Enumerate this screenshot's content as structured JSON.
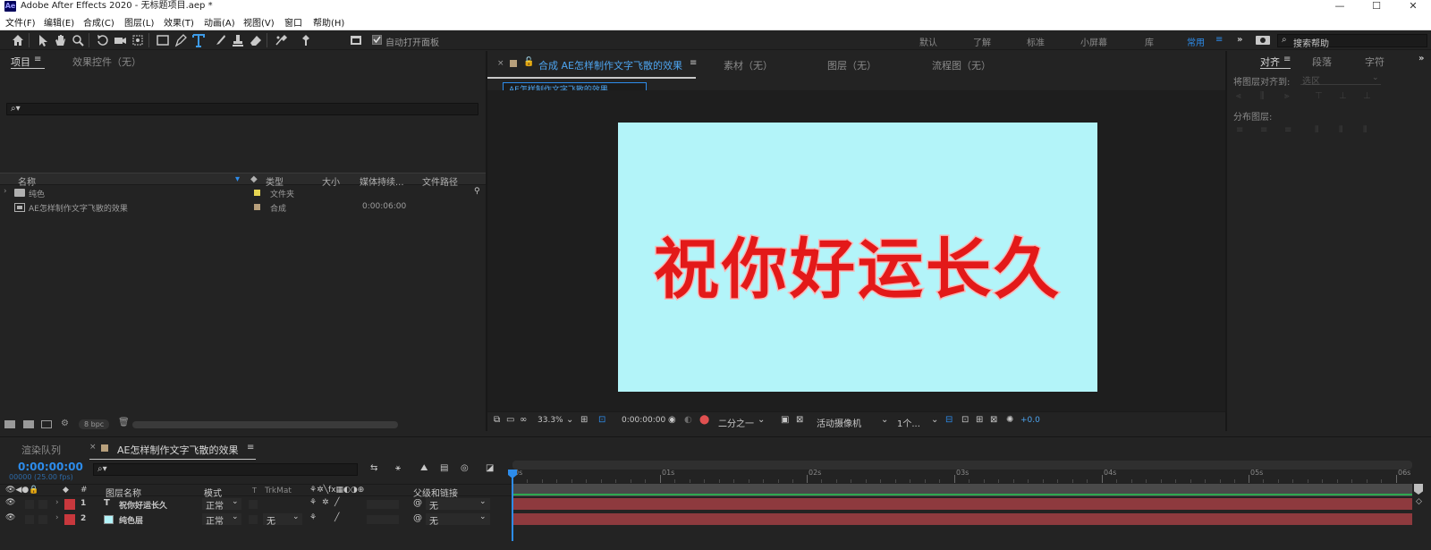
{
  "app": {
    "logo": "Ae",
    "window_title": "Adobe After Effects 2020 - 无标题项目.aep *",
    "controls": [
      "—",
      "☐",
      "✕"
    ]
  },
  "menu": [
    "文件(F)",
    "编辑(E)",
    "合成(C)",
    "图层(L)",
    "效果(T)",
    "动画(A)",
    "视图(V)",
    "窗口",
    "帮助(H)"
  ],
  "toolbar": {
    "auto_open_label": "自动打开面板",
    "workspaces": [
      "默认",
      "了解",
      "标准",
      "小屏幕",
      "库"
    ],
    "active_workspace": "常用",
    "search_help_placeholder": "搜索帮助"
  },
  "project_panel": {
    "tabs": [
      "项目",
      "效果控件（无）"
    ],
    "columns": [
      "名称",
      "类型",
      "大小",
      "媒体持续...",
      "文件路径"
    ],
    "items": [
      {
        "name": "纯色",
        "label_color": "#e6d552",
        "type": "文件夹",
        "duration": "",
        "icon": "folder-icon"
      },
      {
        "name": "AE怎样制作文字飞散的效果",
        "label_color": "#b8a07c",
        "type": "合成",
        "duration": "0:00:06:00",
        "icon": "composition-icon"
      }
    ],
    "bpc": "8 bpc"
  },
  "composition_panel": {
    "tab_title": "合成 AE怎样制作文字飞散的效果",
    "other_tabs": [
      "素材（无）",
      "图层（无）",
      "流程图（无）"
    ],
    "breadcrumb": "AE怎样制作文字飞散的效果",
    "canvas_text": "祝你好运长久",
    "canvas_color": "#b3f4f9",
    "text_color": "#e31919",
    "footer": {
      "zoom": "33.3%",
      "timecode": "0:00:00:00",
      "resolution": "二分之一",
      "camera": "活动摄像机",
      "views": "1个...",
      "exposure": "+0.0"
    }
  },
  "align_panel": {
    "tabs": [
      "对齐",
      "段落",
      "字符"
    ],
    "align_to_label": "将图层对齐到:",
    "align_to_value": "选区",
    "distribute_label": "分布图层:"
  },
  "timeline": {
    "tabs": [
      "渲染队列",
      "AE怎样制作文字飞散的效果"
    ],
    "current_time": "0:00:00:00",
    "fps": "00000 (25.00 fps)",
    "columns": {
      "number": "#",
      "layer_name": "图层名称",
      "mode": "模式",
      "t": "T",
      "trkmat": "TrkMat",
      "parent": "父级和链接"
    },
    "ruler_ticks": [
      "0s",
      "01s",
      "02s",
      "03s",
      "04s",
      "05s",
      "06s"
    ],
    "layers": [
      {
        "index": "1",
        "type_icon": "T",
        "name": "祝你好运长久",
        "label_color": "#c8383d",
        "mode": "正常",
        "trkmat": "",
        "parent": "无"
      },
      {
        "index": "2",
        "type_icon": "solid",
        "name": "纯色层",
        "label_color": "#c8383d",
        "mode": "正常",
        "trkmat": "无",
        "parent": "无"
      }
    ]
  }
}
